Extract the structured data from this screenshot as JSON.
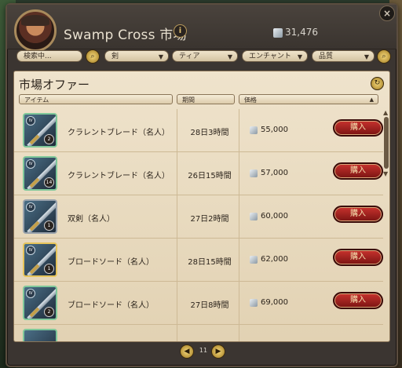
{
  "window": {
    "title": "Swamp Cross 市場",
    "info_icon": "i",
    "silver_icon": "silver-coins-icon",
    "silver_amount": "31,476",
    "close_icon": "×"
  },
  "filters": {
    "search_placeholder": "検索中...",
    "search_button_icon": "search-icon",
    "category": "剣",
    "tier": "ティア",
    "enchant": "エンチャント",
    "quality": "品質",
    "apply_button_icon": "search-icon",
    "dropdown_arrow": "▼"
  },
  "panel": {
    "title": "市場オファー",
    "refresh_icon": "refresh-icon",
    "columns": {
      "item": "アイテム",
      "duration": "期間",
      "price": "価格",
      "price_sort": "▲"
    }
  },
  "offers": [
    {
      "name": "クラレントブレード（名人）",
      "duration": "28日3時間",
      "price": "55,000",
      "tier": "IV",
      "enchant": "2",
      "buy": "購入"
    },
    {
      "name": "クラレントブレード（名人）",
      "duration": "26日15時間",
      "price": "57,000",
      "tier": "IV",
      "enchant": "14",
      "buy": "購入"
    },
    {
      "name": "双剣（名人）",
      "duration": "27日2時間",
      "price": "60,000",
      "tier": "IV",
      "enchant": "1",
      "buy": "購入"
    },
    {
      "name": "ブロードソード（名人）",
      "duration": "28日15時間",
      "price": "62,000",
      "tier": "IV",
      "enchant": "1",
      "buy": "購入"
    },
    {
      "name": "ブロードソード（名人）",
      "duration": "27日8時間",
      "price": "69,000",
      "tier": "IV",
      "enchant": "2",
      "buy": "購入"
    }
  ],
  "scrollbar": {
    "up": "▲",
    "down": "▼"
  },
  "pager": {
    "prev": "◀",
    "page": "11",
    "next": "▶"
  },
  "colors": {
    "buy_button": "#a0221f",
    "panel_bg": "#e8dabe",
    "window_bg": "#3b3531"
  }
}
